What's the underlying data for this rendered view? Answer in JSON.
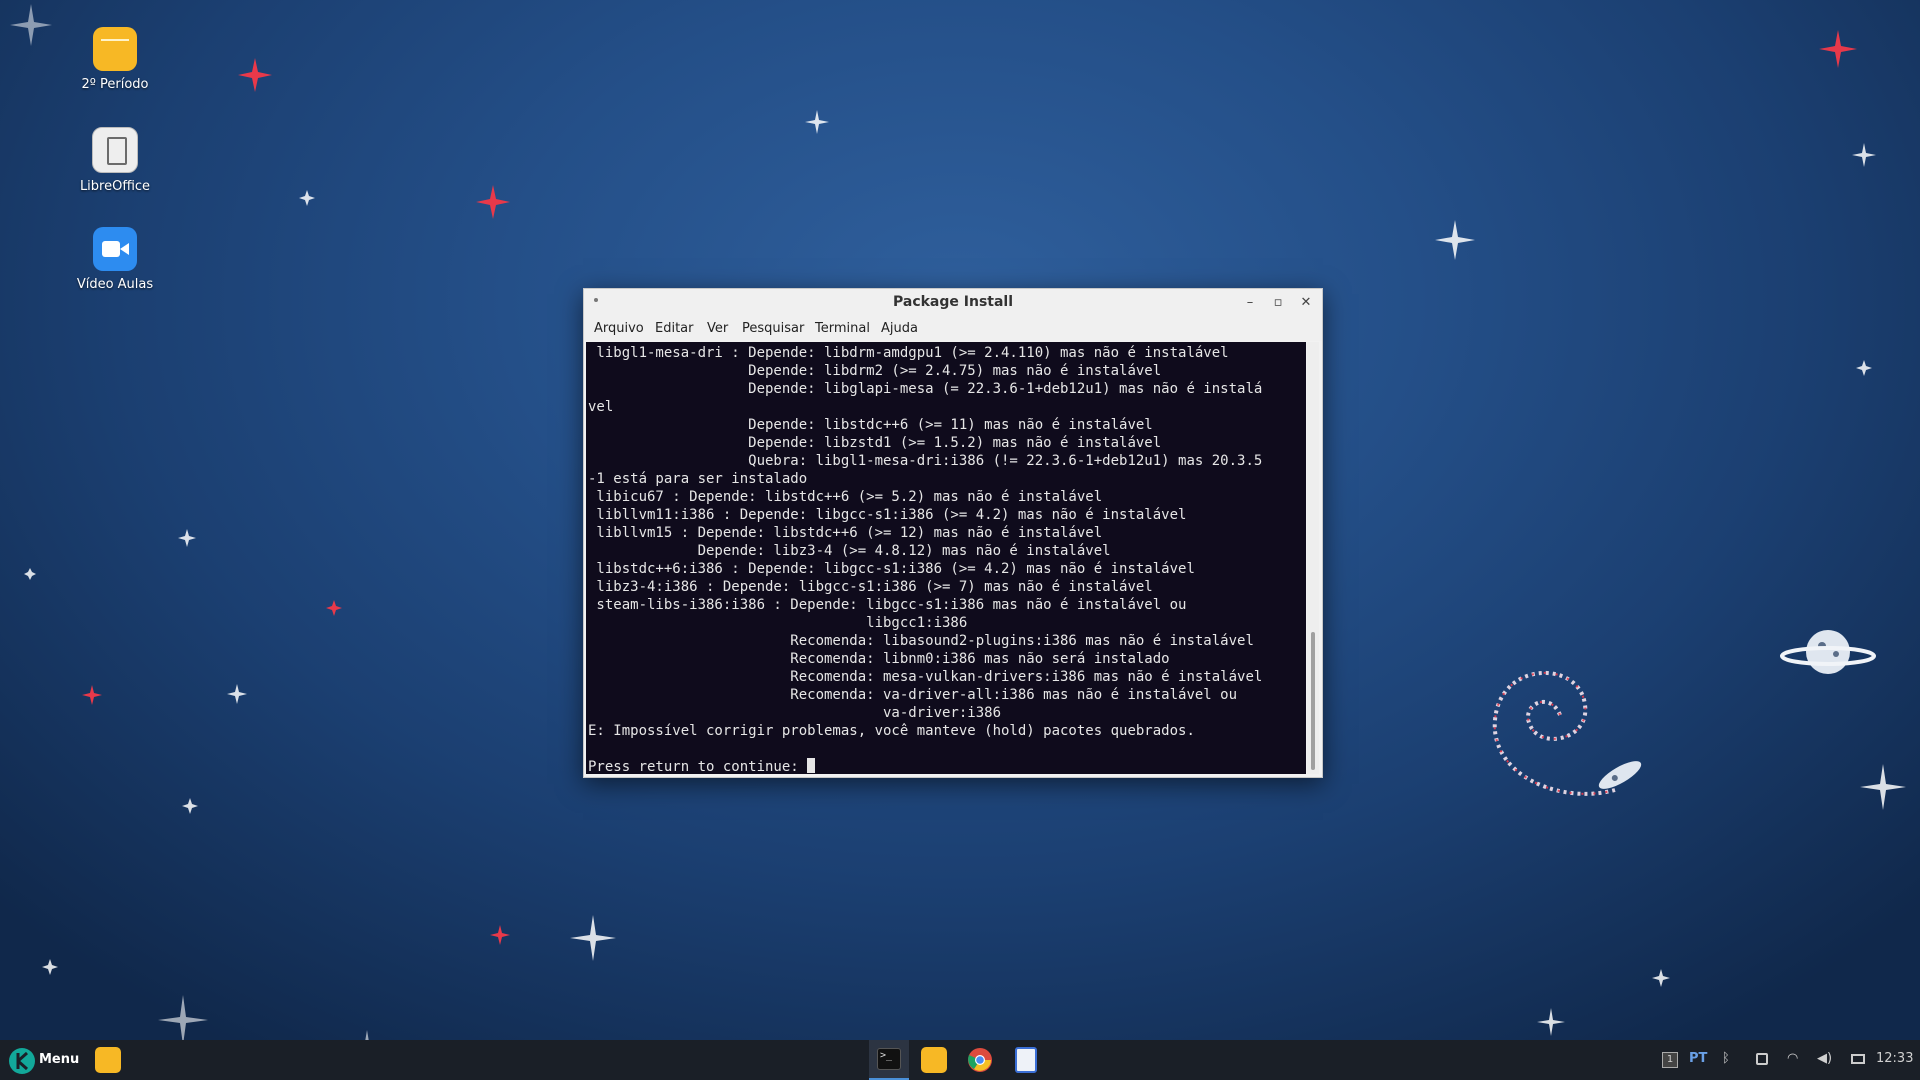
{
  "desktop": {
    "icons": [
      {
        "label": "2º Período",
        "icon": "folder-icon",
        "color": "#f7b825"
      },
      {
        "label": "LibreOffice",
        "icon": "document-icon",
        "color": "#e8e8e8"
      },
      {
        "label": "Vídeo Aulas",
        "icon": "video-camera-icon",
        "color": "#2d8cf0"
      }
    ]
  },
  "window": {
    "title": "Package Install",
    "menu": [
      "Arquivo",
      "Editar",
      "Ver",
      "Pesquisar",
      "Terminal",
      "Ajuda"
    ],
    "buttons": {
      "minimize": "–",
      "maximize": "▫",
      "close": "✕"
    }
  },
  "terminal": {
    "lines": [
      " libgl1-mesa-dri : Depende: libdrm-amdgpu1 (>= 2.4.110) mas não é instalável",
      "                   Depende: libdrm2 (>= 2.4.75) mas não é instalável",
      "                   Depende: libglapi-mesa (= 22.3.6-1+deb12u1) mas não é instalá",
      "vel",
      "                   Depende: libstdc++6 (>= 11) mas não é instalável",
      "                   Depende: libzstd1 (>= 1.5.2) mas não é instalável",
      "                   Quebra: libgl1-mesa-dri:i386 (!= 22.3.6-1+deb12u1) mas 20.3.5",
      "-1 está para ser instalado",
      " libicu67 : Depende: libstdc++6 (>= 5.2) mas não é instalável",
      " libllvm11:i386 : Depende: libgcc-s1:i386 (>= 4.2) mas não é instalável",
      " libllvm15 : Depende: libstdc++6 (>= 12) mas não é instalável",
      "             Depende: libz3-4 (>= 4.8.12) mas não é instalável",
      " libstdc++6:i386 : Depende: libgcc-s1:i386 (>= 4.2) mas não é instalável",
      " libz3-4:i386 : Depende: libgcc-s1:i386 (>= 7) mas não é instalável",
      " steam-libs-i386:i386 : Depende: libgcc-s1:i386 mas não é instalável ou",
      "                                 libgcc1:i386",
      "                        Recomenda: libasound2-plugins:i386 mas não é instalável",
      "                        Recomenda: libnm0:i386 mas não será instalado",
      "                        Recomenda: mesa-vulkan-drivers:i386 mas não é instalável",
      "                        Recomenda: va-driver-all:i386 mas não é instalável ou",
      "                                   va-driver:i386",
      "E: Impossível corrigir problemas, você manteve (hold) pacotes quebrados.",
      ""
    ],
    "prompt": "Press return to continue: "
  },
  "taskbar": {
    "menu_label": "Menu",
    "apps": [
      {
        "name": "file-manager",
        "icon": "folder-icon"
      },
      {
        "name": "terminal",
        "icon": "terminal-icon"
      },
      {
        "name": "files",
        "icon": "folder-icon"
      },
      {
        "name": "chrome",
        "icon": "chrome-icon"
      },
      {
        "name": "writer",
        "icon": "document-icon"
      }
    ],
    "workspace": "1",
    "keyboard_layout": "PT",
    "clock": "12:33"
  },
  "colors": {
    "terminal_bg": "#0f0b1c",
    "terminal_fg": "#e6e6e6",
    "taskbar_bg": "#1a1f27",
    "accent": "#2d8cf0"
  }
}
